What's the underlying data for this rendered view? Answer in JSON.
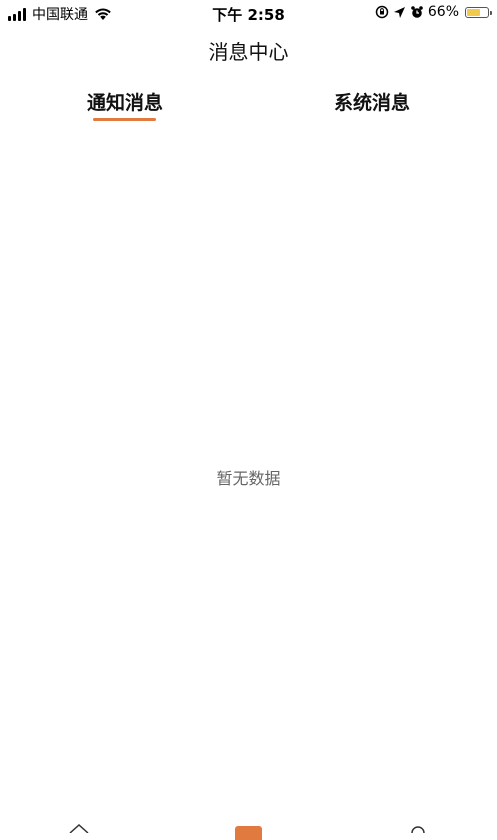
{
  "status_bar": {
    "carrier": "中国联通",
    "time": "下午 2:58",
    "battery_percent": "66%",
    "battery_level": 0.66
  },
  "header": {
    "title": "消息中心"
  },
  "tabs": [
    {
      "label": "通知消息",
      "active": true
    },
    {
      "label": "系统消息",
      "active": false
    }
  ],
  "empty_state": {
    "text": "暂无数据"
  },
  "colors": {
    "accent": "#e07a3e",
    "battery": "#f2c94c"
  },
  "bottom_nav": {
    "icons": [
      "home-icon",
      "center-action-icon",
      "user-icon"
    ]
  }
}
